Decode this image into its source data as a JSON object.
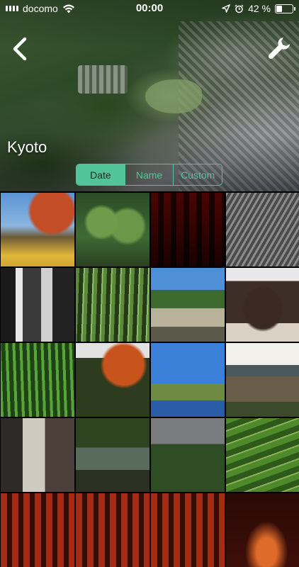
{
  "status_bar": {
    "carrier": "docomo",
    "time": "00:00",
    "battery": "42 %",
    "battery_level_percent": 42
  },
  "header": {
    "title": "Kyoto",
    "back_icon": "chevron-left-icon",
    "settings_icon": "wrench-icon"
  },
  "sort_control": {
    "options": [
      "Date",
      "Name",
      "Custom"
    ],
    "selected": "Date",
    "accent_color": "#52c49a"
  },
  "photos": {
    "count_visible": 20
  }
}
